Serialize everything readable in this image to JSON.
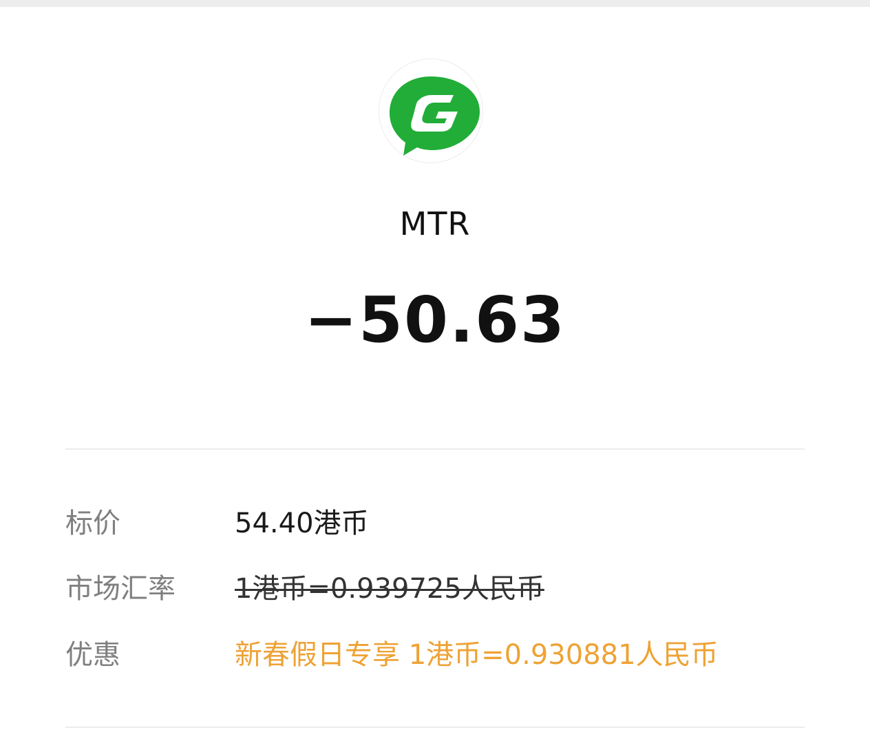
{
  "merchant": {
    "logo_icon": "green-g-chat-bubble-icon",
    "logo_color": "#22ad38",
    "name": "MTR"
  },
  "transaction": {
    "amount": "−50.63"
  },
  "details": {
    "list_price_label": "标价",
    "list_price_value": "54.40港币",
    "market_rate_label": "市场汇率",
    "market_rate_value": "1港币=0.939725人民币",
    "discount_label": "优惠",
    "discount_value": "新春假日专享 1港币=0.930881人民币",
    "discount_color": "#eea234"
  }
}
